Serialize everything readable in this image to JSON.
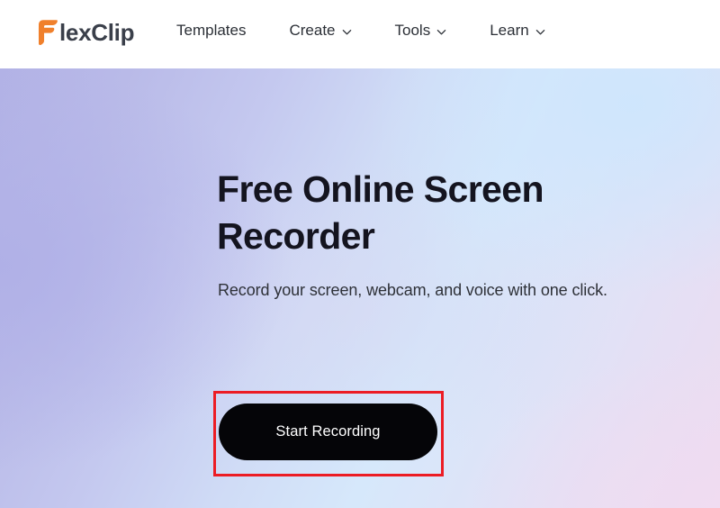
{
  "header": {
    "logo": {
      "mark_name": "flexclip-f-mark",
      "mark_color": "#f0802c",
      "text": "lexClip",
      "text_color": "#3a3f4a",
      "full_name": "FlexClip"
    },
    "nav": [
      {
        "label": "Templates",
        "has_dropdown": false,
        "icon": ""
      },
      {
        "label": "Create",
        "has_dropdown": true,
        "icon": "chevron-down-icon"
      },
      {
        "label": "Tools",
        "has_dropdown": true,
        "icon": "chevron-down-icon"
      },
      {
        "label": "Learn",
        "has_dropdown": true,
        "icon": "chevron-down-icon"
      }
    ]
  },
  "hero": {
    "headline": "Free Online Screen Recorder",
    "subtitle": "Record your screen, webcam, and voice with one click.",
    "cta": {
      "label": "Start Recording",
      "background_color": "#050508",
      "text_color": "#ffffff"
    },
    "annotation": {
      "type": "highlight-rectangle",
      "color": "#ec1c24",
      "border_width_px": 3
    },
    "background": {
      "left_color": "#b2b2e6",
      "top_right_color": "#d6e8fb",
      "bottom_right_color": "#eddcf0"
    }
  }
}
